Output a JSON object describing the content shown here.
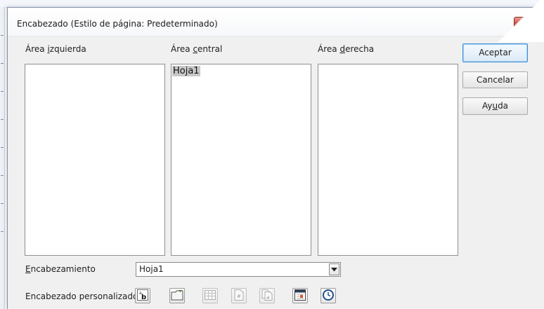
{
  "dialog": {
    "title": "Encabezado (Estilo de página: Predeterminado)",
    "close_glyph": "✕"
  },
  "areas": {
    "left": {
      "label_pre": "Área ",
      "label_key": "i",
      "label_post": "zquierda",
      "content": ""
    },
    "center": {
      "label_pre": "Área ",
      "label_key": "c",
      "label_post": "entral",
      "content": "Hoja1"
    },
    "right": {
      "label_pre": "Área ",
      "label_key": "d",
      "label_post": "erecha",
      "content": ""
    }
  },
  "buttons": {
    "ok": "Aceptar",
    "cancel": "Cancelar",
    "help_pre": "Ay",
    "help_key": "u",
    "help_post": "da"
  },
  "header_field": {
    "label_key": "E",
    "label_post": "ncabezamiento",
    "value": "Hoja1"
  },
  "custom_header": {
    "label": "Encabezado personalizado",
    "tools": [
      {
        "icon": "text-attributes-icon"
      },
      {
        "icon": "file-name-icon"
      },
      {
        "icon": "sheet-name-icon"
      },
      {
        "icon": "page-number-icon"
      },
      {
        "icon": "page-count-icon"
      },
      {
        "icon": "date-icon"
      },
      {
        "icon": "time-icon"
      }
    ]
  },
  "colors": {
    "close_red": "#c9483a",
    "default_button_border": "#3c8ed6",
    "selection_gray": "#c8c8c8"
  }
}
